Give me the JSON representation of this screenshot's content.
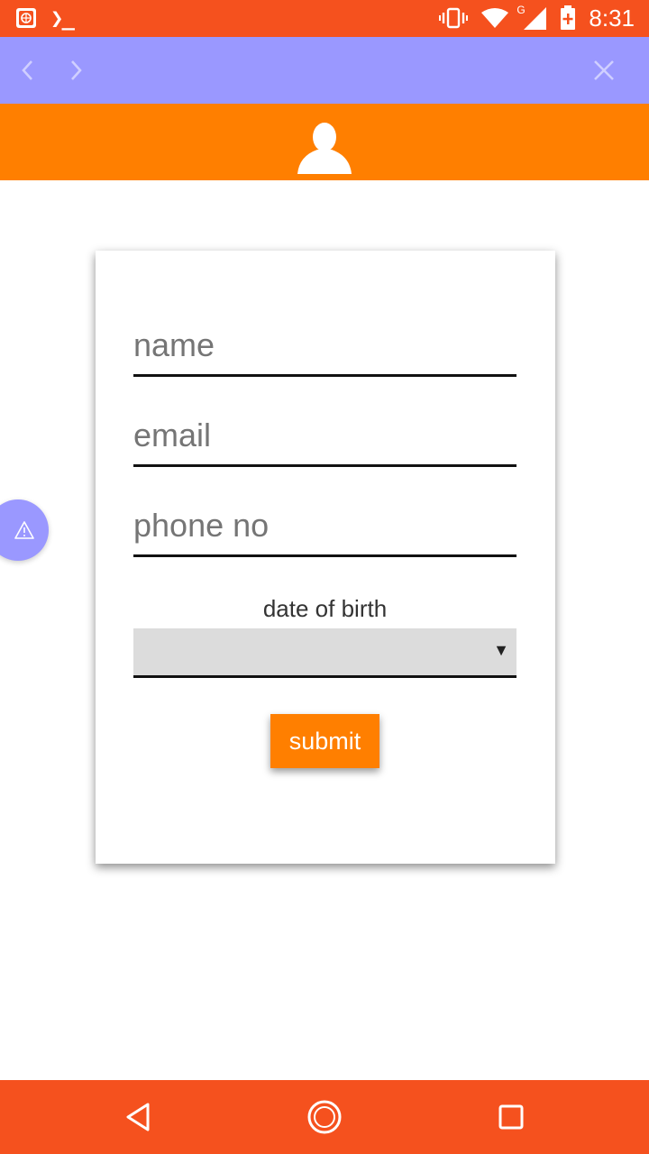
{
  "status_bar": {
    "time": "8:31",
    "network_label": "G",
    "icons": [
      "app-icon",
      "terminal-icon",
      "vibrate-icon",
      "wifi-icon",
      "signal-icon",
      "battery-charging-icon"
    ],
    "terminal_glyph": "❯_"
  },
  "nav_bar": {
    "icons": [
      "chevron-left-icon",
      "chevron-right-icon",
      "close-icon"
    ]
  },
  "header": {
    "icon": "user-icon"
  },
  "form": {
    "name_placeholder": "name",
    "email_placeholder": "email",
    "phone_placeholder": "phone no",
    "dob_label": "date of birth",
    "dob_value": "",
    "dob_arrow": "▼",
    "submit_label": "submit"
  },
  "fab": {
    "icon": "warning-icon"
  },
  "system_nav": {
    "icons": [
      "back-triangle-icon",
      "home-circle-icon",
      "recents-square-icon"
    ]
  },
  "colors": {
    "status_bar": "#F5511E",
    "nav_bar": "#9A98FF",
    "header": "#FF7F00",
    "submit": "#FF7F00",
    "dob_select": "#DCDCDC"
  }
}
